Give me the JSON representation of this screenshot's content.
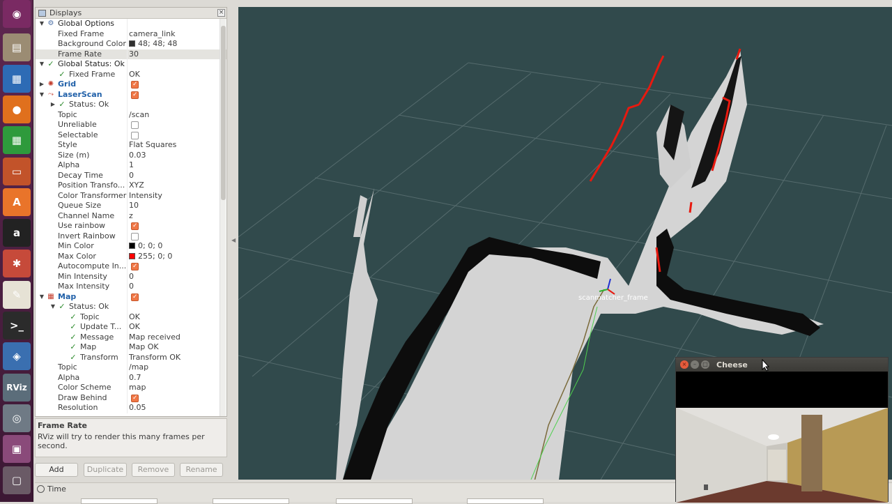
{
  "launcher": {
    "items": [
      {
        "name": "ubuntu-logo-icon",
        "glyph": "◉",
        "color": "#7a2a63"
      },
      {
        "name": "files-icon",
        "glyph": "▤",
        "color": "#9b8c73"
      },
      {
        "name": "writer-icon",
        "glyph": "▦",
        "color": "#2d6bb5"
      },
      {
        "name": "firefox-icon",
        "glyph": "●",
        "color": "#e0701d"
      },
      {
        "name": "calc-icon",
        "glyph": "▦",
        "color": "#2e9a3c"
      },
      {
        "name": "impress-icon",
        "glyph": "▭",
        "color": "#c2532a"
      },
      {
        "name": "software-center-icon",
        "glyph": "A",
        "color": "#e9742a"
      },
      {
        "name": "amazon-icon",
        "glyph": "a",
        "color": "#222222"
      },
      {
        "name": "settings-icon",
        "glyph": "✱",
        "color": "#c64a3a"
      },
      {
        "name": "text-editor-icon",
        "glyph": "✎",
        "color": "#e6e2d5"
      },
      {
        "name": "terminal-icon",
        "glyph": ">_",
        "color": "#2b2b2b"
      },
      {
        "name": "rqt-icon",
        "glyph": "◈",
        "color": "#3a6fb0"
      },
      {
        "name": "rviz-icon",
        "glyph": "RViz",
        "color": "#5b6d7a"
      },
      {
        "name": "cheese-icon",
        "glyph": "◎",
        "color": "#6f7a85"
      },
      {
        "name": "workspace-icon",
        "glyph": "▣",
        "color": "#8a4a7a"
      },
      {
        "name": "trash-icon",
        "glyph": "▢",
        "color": "#6a5a66"
      }
    ]
  },
  "displays_panel": {
    "title": "Displays",
    "rows": [
      {
        "indent": 0,
        "arrow": "▼",
        "icon": "⚙",
        "name": "Global Options",
        "value": "",
        "kind": "text",
        "style": "blk"
      },
      {
        "indent": 1,
        "name": "Fixed Frame",
        "value": "camera_link",
        "kind": "text"
      },
      {
        "indent": 1,
        "name": "Background Color",
        "value": "48; 48; 48",
        "kind": "color",
        "color": "#303030"
      },
      {
        "indent": 1,
        "name": "Frame Rate",
        "value": "30",
        "kind": "text",
        "selected": true
      },
      {
        "indent": 0,
        "arrow": "▼",
        "check": true,
        "name": "Global Status: Ok",
        "value": "",
        "kind": "text",
        "style": "blk"
      },
      {
        "indent": 1,
        "check": true,
        "name": "Fixed Frame",
        "value": "OK",
        "kind": "text"
      },
      {
        "indent": 0,
        "arrow": "▶",
        "icon": "✺",
        "name": "Grid",
        "value": "",
        "kind": "checkbox",
        "checked": true,
        "style": "bold"
      },
      {
        "indent": 0,
        "arrow": "▼",
        "icon": "⤳",
        "name": "LaserScan",
        "value": "",
        "kind": "checkbox",
        "checked": true,
        "style": "bold"
      },
      {
        "indent": 1,
        "arrow": "▶",
        "check": true,
        "name": "Status: Ok",
        "value": "",
        "kind": "text"
      },
      {
        "indent": 1,
        "name": "Topic",
        "value": "/scan",
        "kind": "text"
      },
      {
        "indent": 1,
        "name": "Unreliable",
        "value": "",
        "kind": "checkbox",
        "checked": false
      },
      {
        "indent": 1,
        "name": "Selectable",
        "value": "",
        "kind": "checkbox",
        "checked": false
      },
      {
        "indent": 1,
        "name": "Style",
        "value": "Flat Squares",
        "kind": "text"
      },
      {
        "indent": 1,
        "name": "Size (m)",
        "value": "0.03",
        "kind": "text"
      },
      {
        "indent": 1,
        "name": "Alpha",
        "value": "1",
        "kind": "text"
      },
      {
        "indent": 1,
        "name": "Decay Time",
        "value": "0",
        "kind": "text"
      },
      {
        "indent": 1,
        "name": "Position Transfo...",
        "value": "XYZ",
        "kind": "text"
      },
      {
        "indent": 1,
        "name": "Color Transformer",
        "value": "Intensity",
        "kind": "text"
      },
      {
        "indent": 1,
        "name": "Queue Size",
        "value": "10",
        "kind": "text"
      },
      {
        "indent": 1,
        "name": "Channel Name",
        "value": "z",
        "kind": "text"
      },
      {
        "indent": 1,
        "name": "Use rainbow",
        "value": "",
        "kind": "checkbox",
        "checked": true
      },
      {
        "indent": 1,
        "name": "Invert Rainbow",
        "value": "",
        "kind": "checkbox",
        "checked": false
      },
      {
        "indent": 1,
        "name": "Min Color",
        "value": "0; 0; 0",
        "kind": "color",
        "color": "#000000"
      },
      {
        "indent": 1,
        "name": "Max Color",
        "value": "255; 0; 0",
        "kind": "color",
        "color": "#ff0000"
      },
      {
        "indent": 1,
        "name": "Autocompute In...",
        "value": "",
        "kind": "checkbox",
        "checked": true
      },
      {
        "indent": 1,
        "name": "Min Intensity",
        "value": "0",
        "kind": "text"
      },
      {
        "indent": 1,
        "name": "Max Intensity",
        "value": "0",
        "kind": "text"
      },
      {
        "indent": 0,
        "arrow": "▼",
        "icon": "▦",
        "name": "Map",
        "value": "",
        "kind": "checkbox",
        "checked": true,
        "style": "bold"
      },
      {
        "indent": 1,
        "arrow": "▼",
        "check": true,
        "name": "Status: Ok",
        "value": "",
        "kind": "text"
      },
      {
        "indent": 2,
        "check": true,
        "name": "Topic",
        "value": "OK",
        "kind": "text"
      },
      {
        "indent": 2,
        "check": true,
        "name": "Update T...",
        "value": "OK",
        "kind": "text"
      },
      {
        "indent": 2,
        "check": true,
        "name": "Message",
        "value": "Map received",
        "kind": "text"
      },
      {
        "indent": 2,
        "check": true,
        "name": "Map",
        "value": "Map OK",
        "kind": "text"
      },
      {
        "indent": 2,
        "check": true,
        "name": "Transform",
        "value": "Transform OK",
        "kind": "text"
      },
      {
        "indent": 1,
        "name": "Topic",
        "value": "/map",
        "kind": "text"
      },
      {
        "indent": 1,
        "name": "Alpha",
        "value": "0.7",
        "kind": "text"
      },
      {
        "indent": 1,
        "name": "Color Scheme",
        "value": "map",
        "kind": "text"
      },
      {
        "indent": 1,
        "name": "Draw Behind",
        "value": "",
        "kind": "checkbox",
        "checked": true
      },
      {
        "indent": 1,
        "name": "Resolution",
        "value": "0.05",
        "kind": "text"
      }
    ]
  },
  "help": {
    "title": "Frame Rate",
    "text": "RViz will try to render this many frames per second."
  },
  "buttons": {
    "add": "Add",
    "duplicate": "Duplicate",
    "remove": "Remove",
    "rename": "Rename"
  },
  "time_panel": {
    "title": "Time"
  },
  "viewport": {
    "frame_label": "scanmatcher_frame",
    "background": "#314a4c",
    "scan_color": "#e8190f"
  },
  "cheese": {
    "title": "Cheese"
  }
}
